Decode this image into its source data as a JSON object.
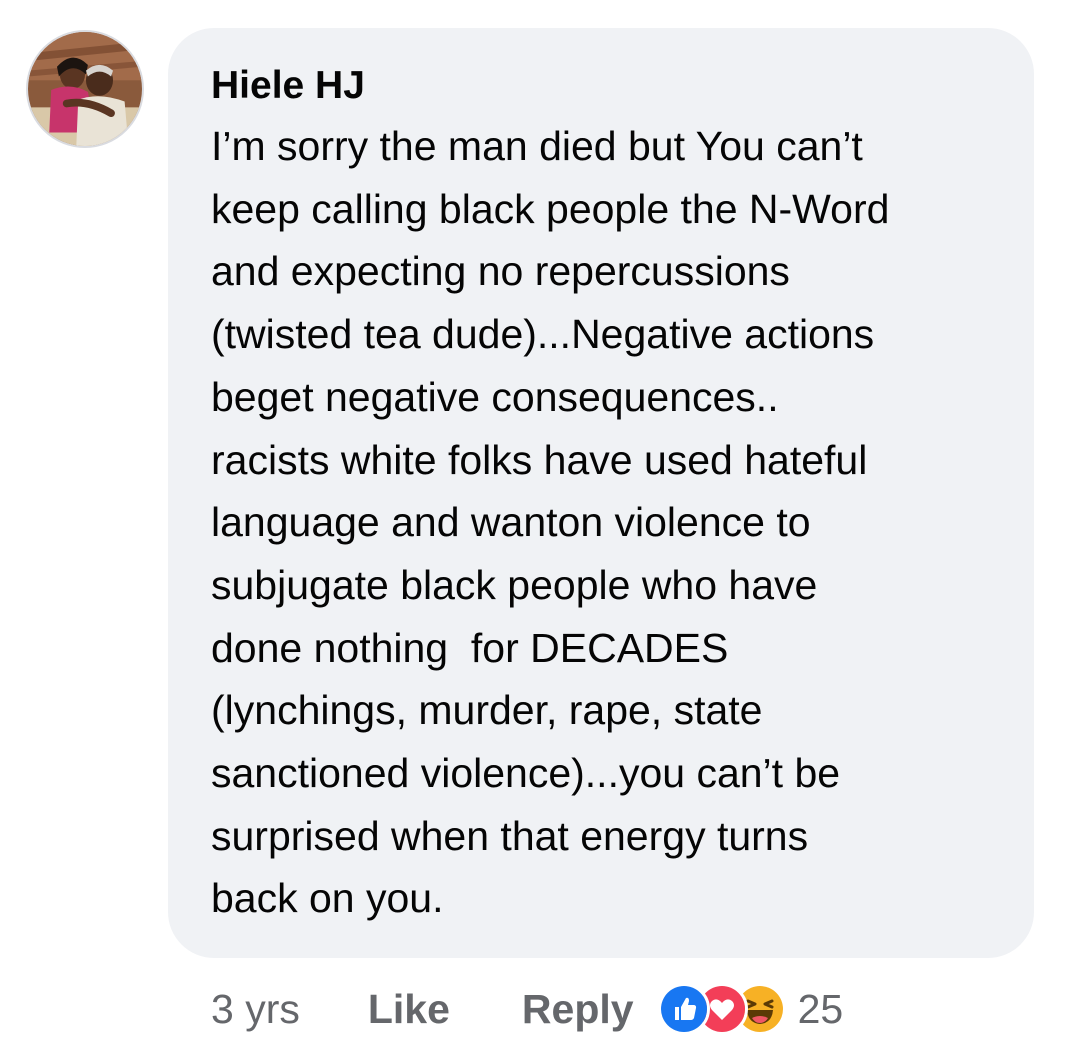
{
  "comment": {
    "author": "Hiele HJ",
    "lines": [
      "I’m sorry the man died but You can’t",
      "keep calling black people the N-Word",
      "and expecting no repercussions",
      "(twisted tea dude)...Negative actions",
      "beget negative consequences..",
      "racists white folks have used hateful",
      "language and wanton violence to",
      "subjugate black people who have",
      "done nothing  for DECADES",
      "(lynchings, murder, rape, state",
      "sanctioned violence)...you can’t be",
      "surprised when that energy turns",
      "back on you."
    ]
  },
  "actions": {
    "timestamp": "3 yrs",
    "like_label": "Like",
    "reply_label": "Reply",
    "reaction_count": "25"
  },
  "reactions": [
    "like-icon",
    "love-icon",
    "haha-icon"
  ],
  "colors": {
    "bubble": "#f0f2f5",
    "text": "#050505",
    "meta": "#65676b",
    "like": "#1877f2",
    "love": "#f33e58",
    "haha": "#f7b125"
  }
}
